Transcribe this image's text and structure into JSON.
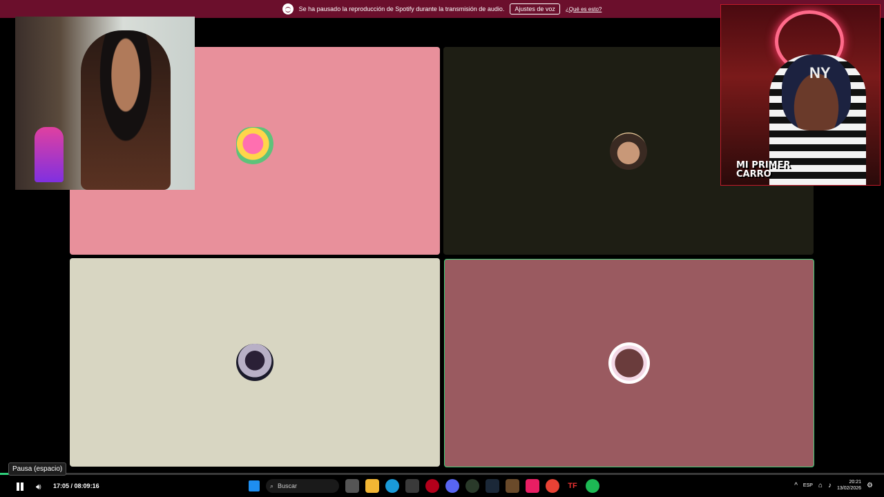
{
  "banner": {
    "message": "Se ha pausado la reproducción de Spotify durante la transmisión de audio.",
    "settings_button": "Ajustes de voz",
    "info_link": "¿Qué es esto?"
  },
  "webcam_right": {
    "caption_line1": "MI PRIMER",
    "caption_line2": "CARRO",
    "cap_logo": "NY"
  },
  "player": {
    "tooltip": "Pausa (espacio)",
    "current_time": "17:05",
    "duration": "08:09:16",
    "progress": 0.035
  },
  "taskbar": {
    "search_placeholder": "Buscar",
    "apps": [
      "windows-icon",
      "task-view-icon",
      "file-explorer-icon",
      "edge-icon",
      "store-icon",
      "red-app-icon",
      "discord-icon",
      "xbox-icon",
      "steam-icon",
      "game-icon",
      "tiktok-icon",
      "chrome-icon",
      "tf-icon",
      "spotify-icon"
    ]
  },
  "tray": {
    "language": "ESP",
    "time": "20:21",
    "date": "13/02/2026"
  },
  "colors": {
    "banner": "#6b0f2c",
    "active_speaker": "#3fd27a",
    "progress": "#2ecf7a"
  }
}
